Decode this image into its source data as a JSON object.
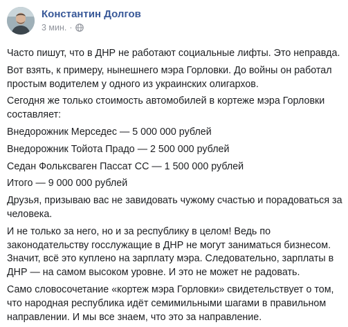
{
  "post": {
    "author": "Константин Долгов",
    "time": "3 мин.",
    "separator": "·",
    "privacy_icon": "globe-icon"
  },
  "body": {
    "p1": "Часто пишут, что в ДНР не работают социальные лифты. Это неправда.",
    "p2": "Вот взять, к примеру, нынешнего мэра Горловки. До войны он работал простым водителем у одного из украинских олигархов.",
    "p3": "Сегодня же только стоимость автомобилей в кортеже мэра Горловки составляет:",
    "p4": "Внедорожник Мерседес — 5 000 000 рублей",
    "p5": "Внедорожник Тойота Прадо — 2 500 000 рублей",
    "p6": "Седан Фольксваген Пассат СС — 1 500 000 рублей",
    "p7": "Итого — 9 000 000 рублей",
    "p8": "Друзья, призываю вас не завидовать чужому счастью и порадоваться за человека.",
    "p9": "И не только за него, но и за республику в целом! Ведь по законодательству госслужащие в ДНР не могут заниматься бизнесом. Значит, всё это куплено на зарплату мэра. Следовательно, зарплаты в ДНР — на самом высоком уровне. И это не может не радовать.",
    "p10": "Само словосочетание «кортеж мэра Горловки» свидетельствует о том, что народная республика идёт семимильными шагами в правильном направлении. И мы все знаем, что это за направление."
  }
}
